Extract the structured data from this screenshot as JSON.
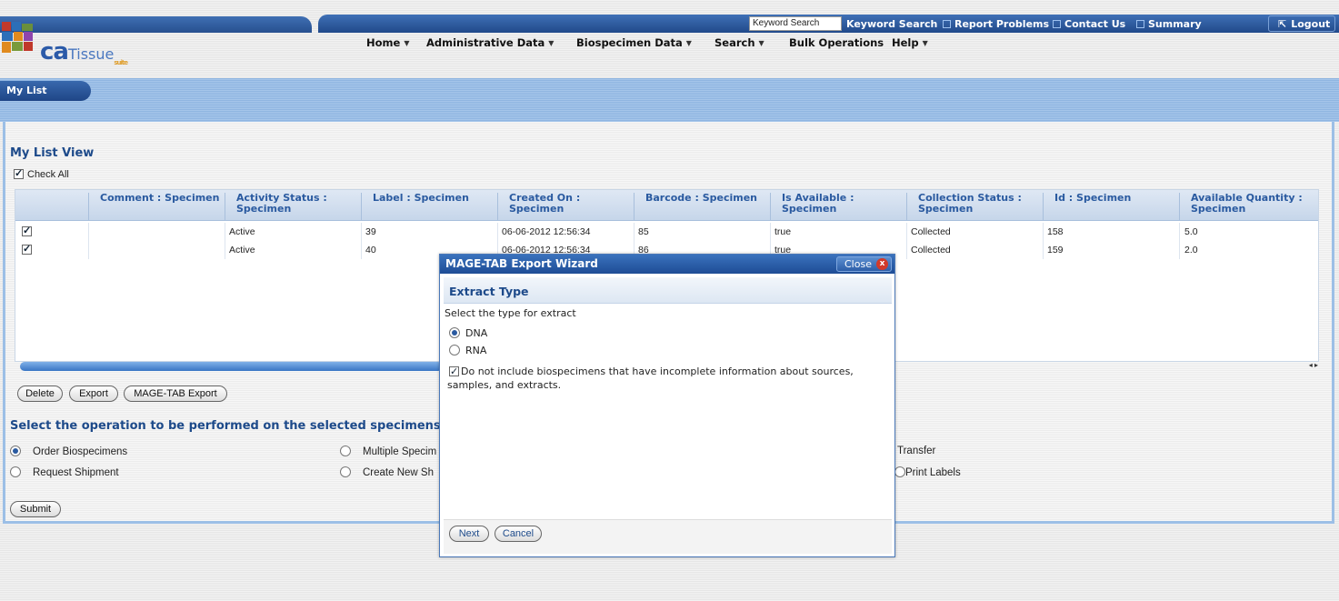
{
  "header": {
    "logo_text": "ca",
    "logo_sub": "Tissue",
    "logo_sup": "suite",
    "keyword_input_value": "Keyword Search",
    "top_links": [
      "Keyword Search",
      "Report Problems",
      "Contact Us",
      "Summary"
    ],
    "logout": "Logout",
    "nav": [
      "Home",
      "Administrative Data",
      "Biospecimen Data",
      "Search",
      "Bulk Operations",
      "Help"
    ]
  },
  "band": {
    "tab": "My List"
  },
  "view": {
    "title": "My List  View",
    "check_all": "Check All"
  },
  "grid": {
    "columns": [
      "Comment : Specimen",
      "Activity Status : Specimen",
      "Label : Specimen",
      "Created On : Specimen",
      "Barcode : Specimen",
      "Is Available : Specimen",
      "Collection Status : Specimen",
      "Id : Specimen",
      "Available Quantity : Specimen"
    ],
    "rows": [
      [
        "",
        "Active",
        "39",
        "06-06-2012 12:56:34",
        "85",
        "true",
        "Collected",
        "158",
        "5.0"
      ],
      [
        "",
        "Active",
        "40",
        "06-06-2012 12:56:34",
        "86",
        "true",
        "Collected",
        "159",
        "2.0"
      ]
    ],
    "scroll_arrows": "◂ ▸"
  },
  "actions": {
    "delete": "Delete",
    "export": "Export",
    "mage_tab_export": "MAGE-TAB Export"
  },
  "operations": {
    "title": "Select the operation to be performed on the selected specimens and cl",
    "order": "Order Biospecimens",
    "request_shipment": "Request Shipment",
    "multiple": "Multiple Specim",
    "create_new": "Create New Sh",
    "transfer": "Transfer",
    "print_labels": "Print Labels",
    "submit": "Submit"
  },
  "dialog": {
    "title": "MAGE-TAB Export Wizard",
    "close": "Close",
    "close_x": "x",
    "section": "Extract Type",
    "prompt": "Select the type for extract",
    "option_dna": "DNA",
    "option_rna": "RNA",
    "exclude_line1": "Do not include biospecimens that have incomplete information about sources,",
    "exclude_line2": "samples, and extracts.",
    "next": "Next",
    "cancel": "Cancel"
  }
}
